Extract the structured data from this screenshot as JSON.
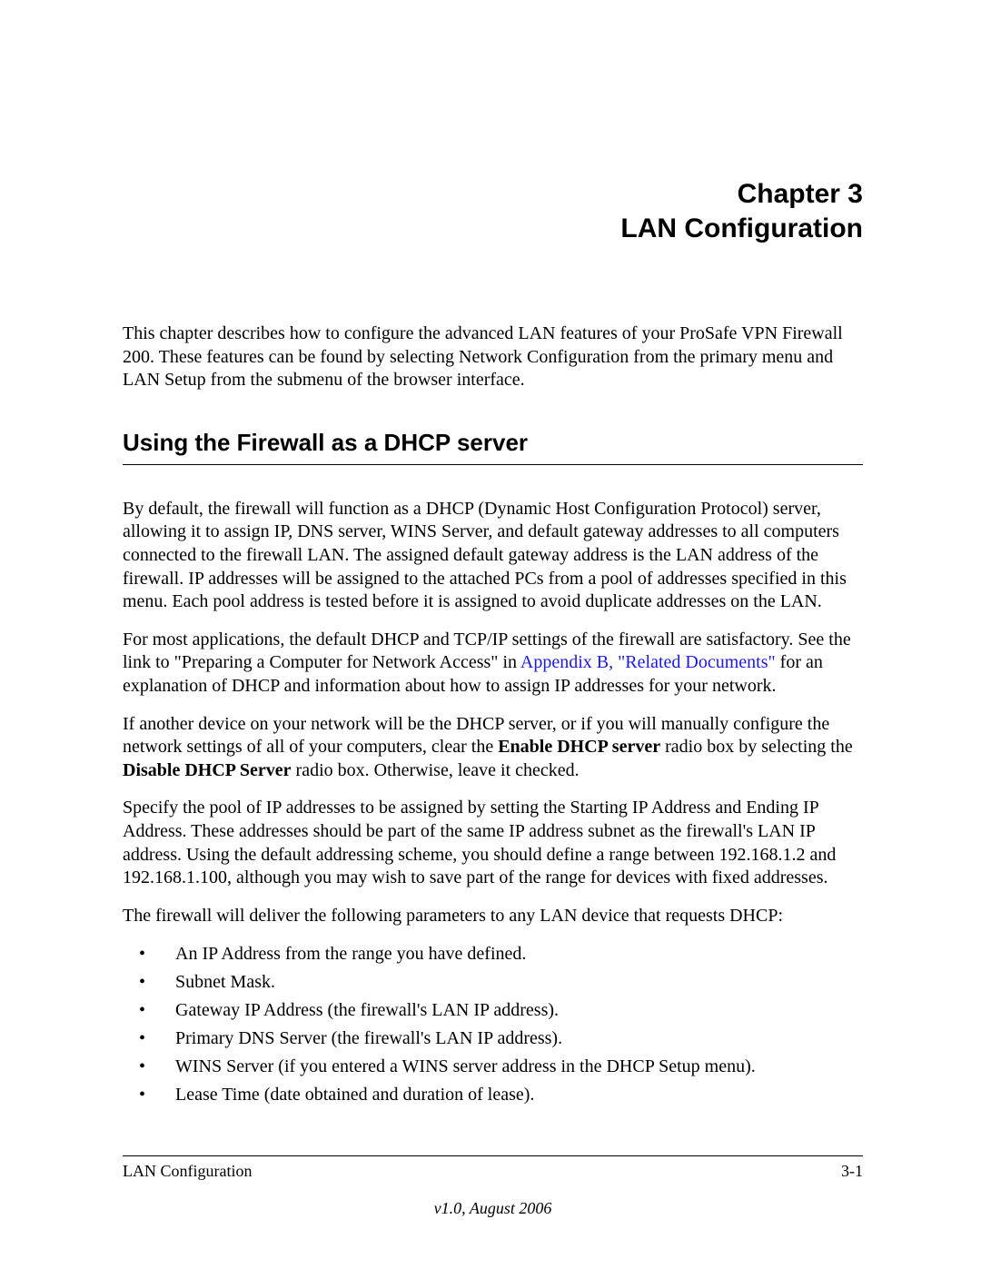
{
  "chapter": {
    "line1": "Chapter 3",
    "line2": "LAN Configuration"
  },
  "intro": "This chapter describes how to configure the advanced LAN features of your ProSafe VPN Firewall 200. These features can be found by selecting Network Configuration from the primary menu and LAN Setup from the submenu of the browser interface.",
  "section_heading": "Using the Firewall as a DHCP server",
  "para1": "By default, the firewall will function as a DHCP (Dynamic Host Configuration Protocol) server, allowing it to assign IP, DNS server, WINS Server, and default gateway addresses to all computers connected to the firewall LAN. The assigned default gateway address is the LAN address of the firewall. IP addresses will be assigned to the attached PCs from a pool of addresses specified in this menu. Each pool address is tested before it is assigned to avoid duplicate addresses on the LAN.",
  "para2_pre": "For most applications, the default DHCP and TCP/IP settings of the firewall are satisfactory. See the link to \"Preparing a Computer for Network Access\" in ",
  "para2_link": "Appendix B, \"Related Documents\"",
  "para2_post": " for an explanation of DHCP and information about how to assign IP addresses for your network.",
  "para3_pre": "If another device on your network will be the DHCP server, or if you will manually configure the network settings of all of your computers, clear the ",
  "para3_bold1": "Enable DHCP server",
  "para3_mid": " radio box by selecting the ",
  "para3_bold2": "Disable DHCP Server",
  "para3_post": " radio box. Otherwise, leave it checked.",
  "para4": "Specify the pool of IP addresses to be assigned by setting the Starting IP Address and Ending IP Address. These addresses should be part of the same IP address subnet as the firewall's LAN IP address. Using the default addressing scheme, you should define a range between 192.168.1.2 and 192.168.1.100, although you may wish to save part of the range for devices with fixed addresses.",
  "para5": "The firewall will deliver the following parameters to any LAN device that requests DHCP:",
  "bullets": [
    "An IP Address from the range you have defined.",
    "Subnet Mask.",
    "Gateway IP Address (the firewall's LAN IP address).",
    "Primary DNS Server (the firewall's LAN IP address).",
    "WINS Server (if you entered a WINS server address in the DHCP Setup menu).",
    "Lease Time (date obtained and duration of lease)."
  ],
  "footer": {
    "left": "LAN Configuration",
    "right": "3-1",
    "version": "v1.0, August 2006"
  }
}
